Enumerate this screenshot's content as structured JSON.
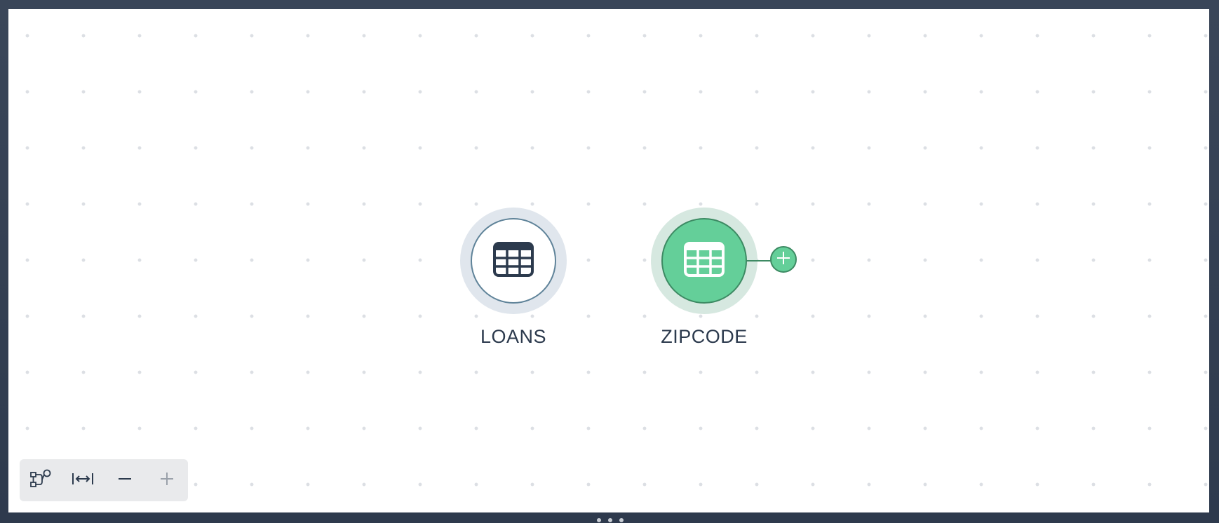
{
  "canvas": {
    "nodes": [
      {
        "label": "LOANS",
        "icon": "table-icon",
        "state": "default"
      },
      {
        "label": "ZIPCODE",
        "icon": "table-icon",
        "state": "selected",
        "accent": "#64cf99"
      }
    ],
    "add_button_icon": "plus-icon"
  },
  "toolbar": {
    "buttons": [
      {
        "icon": "auto-layout-icon"
      },
      {
        "icon": "fit-to-screen-icon"
      },
      {
        "icon": "zoom-out-icon"
      },
      {
        "icon": "zoom-in-icon"
      }
    ]
  },
  "colors": {
    "canvas_bg": "#ffffff",
    "frame_bg": "#3b4658",
    "selected_node": "#64cf99",
    "default_node_border": "#5f8399",
    "text": "#2c3a4d"
  }
}
